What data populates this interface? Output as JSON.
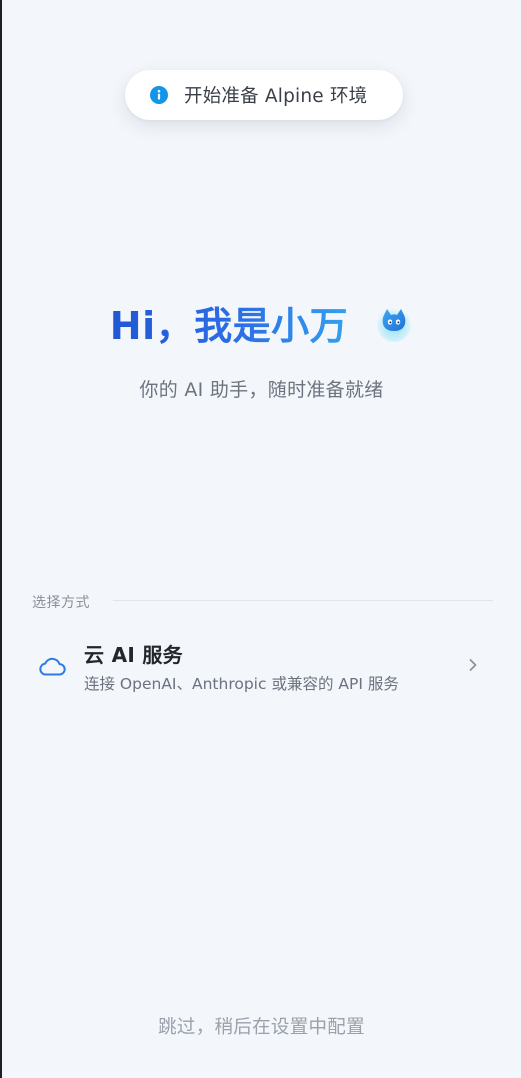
{
  "toast": {
    "icon": "info-icon",
    "text": "开始准备 Alpine 环境"
  },
  "hero": {
    "title": "Hi，我是小万",
    "mascot": "mascot-icon",
    "subtitle": "你的 AI 助手，随时准备就绪"
  },
  "setup": {
    "section_label": "选择方式",
    "options": [
      {
        "icon": "cloud-icon",
        "title": "云 AI 服务",
        "description": "连接 OpenAI、Anthropic 或兼容的 API 服务",
        "action_icon": "chevron-right-icon"
      }
    ]
  },
  "footer": {
    "skip_label": "跳过，稍后在设置中配置"
  },
  "colors": {
    "background": "#f3f6fa",
    "accent": "#2c6fe6",
    "info": "#1196e8"
  }
}
